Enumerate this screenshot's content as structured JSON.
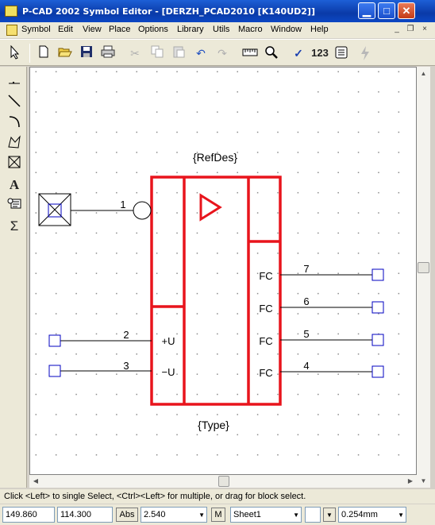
{
  "window": {
    "title": "P-CAD 2002 Symbol Editor - [DERZH_PCAD2010 [K140UD2]]",
    "minimize_glyph": "▁",
    "maximize_glyph": "□",
    "close_glyph": "✕"
  },
  "menu": {
    "items": [
      "Symbol",
      "Edit",
      "View",
      "Place",
      "Options",
      "Library",
      "Utils",
      "Macro",
      "Window",
      "Help"
    ],
    "mdi_minimize": "_",
    "mdi_restore": "❐",
    "mdi_close": "×"
  },
  "toolbar": {
    "select_icon": "select-arrow-icon",
    "counter_label": "123"
  },
  "left_tools": [
    "place-pin-icon",
    "place-line-icon",
    "place-arc-icon",
    "place-polygon-icon",
    "place-ref-point-icon",
    "place-text-icon",
    "place-attribute-icon",
    "place-field-icon"
  ],
  "symbol": {
    "refdes": "{RefDes}",
    "type": "{Type}",
    "pins": [
      {
        "number": "1",
        "label": ""
      },
      {
        "number": "2",
        "label": "+U"
      },
      {
        "number": "3",
        "label": "−U"
      },
      {
        "number": "4",
        "label": "FC"
      },
      {
        "number": "5",
        "label": "FC"
      },
      {
        "number": "6",
        "label": "FC"
      },
      {
        "number": "7",
        "label": "FC"
      }
    ],
    "colors": {
      "body": "#e8141c",
      "pin_line": "#000000",
      "pin_end": "#0000c0"
    }
  },
  "status": {
    "hint": "Click <Left> to single Select, <Ctrl><Left> for multiple, or drag for block select.",
    "x": "149.860",
    "y": "114.300",
    "abs_label": "Abs",
    "grid": "2.540",
    "m_label": "M",
    "sheet": "Sheet1",
    "line_width": "0.254mm"
  }
}
